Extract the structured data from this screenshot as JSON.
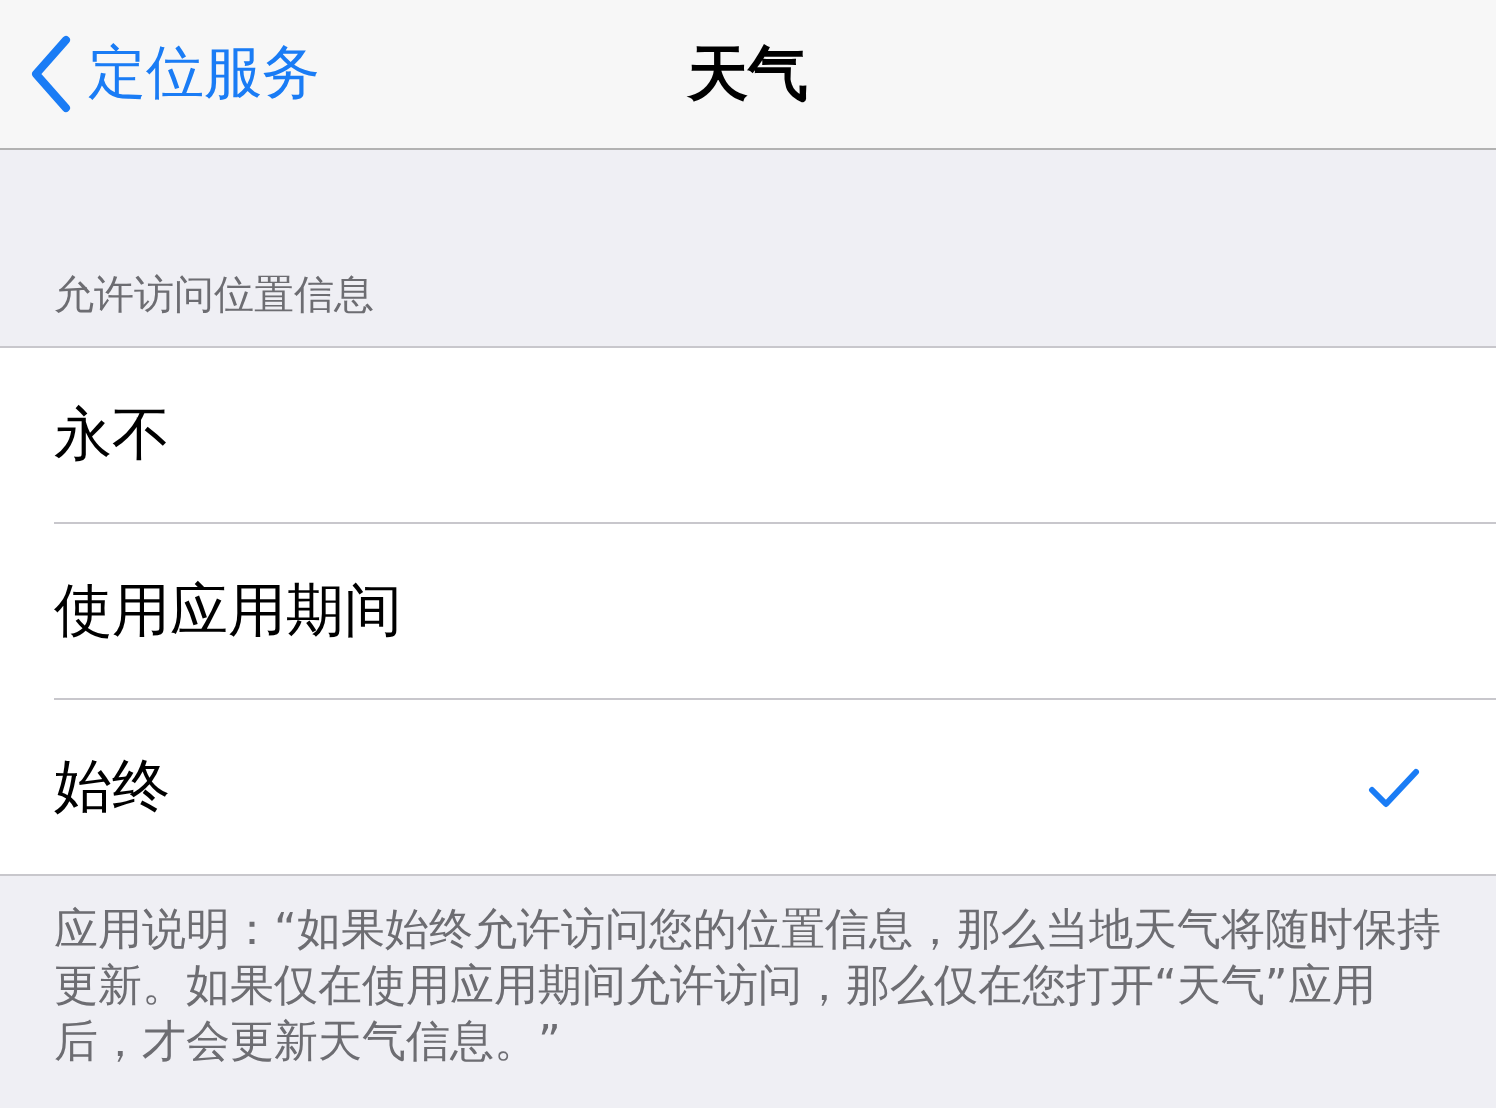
{
  "nav_bar": {
    "back_label": "定位服务",
    "title": "天气"
  },
  "section": {
    "header": "允许访问位置信息",
    "options": [
      {
        "label": "永不",
        "selected": false
      },
      {
        "label": "使用应用期间",
        "selected": false
      },
      {
        "label": "始终",
        "selected": true
      }
    ],
    "footer": "应用说明：“如果始终允许访问您的位置信息，那么当地天气将随时保持更新。如果仅在使用应用期间允许访问，那么仅在您打开“天气”应用后，才会更新天气信息。”"
  }
}
